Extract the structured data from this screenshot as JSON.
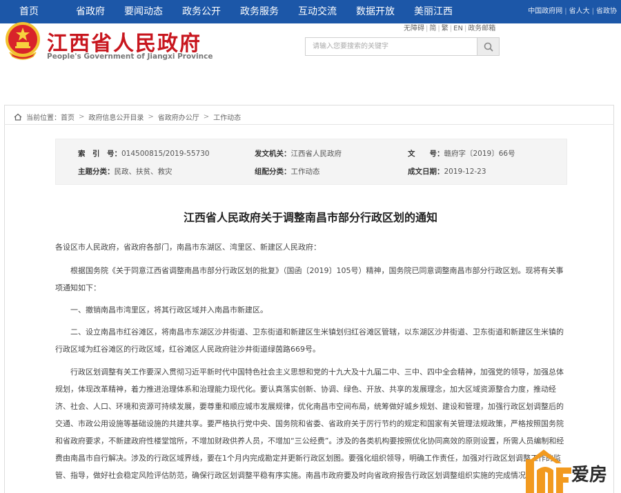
{
  "topnav": {
    "items": [
      "首页",
      "省政府",
      "要闻动态",
      "政务公开",
      "政务服务",
      "互动交流",
      "数据开放",
      "美丽江西"
    ],
    "right_links": [
      "中国政府网",
      "省人大",
      "省政协"
    ]
  },
  "header": {
    "title": "江西省人民政府",
    "subtitle": "People's Government of Jiangxi Province",
    "tools": [
      "无障碍",
      "简",
      "繁",
      "EN",
      "政务邮箱"
    ],
    "search_placeholder": "请输入您要搜索的关键字"
  },
  "breadcrumb": {
    "label": "当前位置：",
    "items": [
      "首页",
      "政府信息公开目录",
      "省政府办公厅",
      "工作动态"
    ]
  },
  "meta": {
    "index_label": "索　引　号：",
    "index_value": "014500815/2019-55730",
    "agency_label": "发文机关：",
    "agency_value": "江西省人民政府",
    "docno_label": "文　　号：",
    "docno_value": "赣府字〔2019〕66号",
    "topic_label": "主题分类：",
    "topic_value": "民政、扶贫、救灾",
    "genre_label": "组配分类：",
    "genre_value": "工作动态",
    "date_label": "成文日期：",
    "date_value": "2019-12-23"
  },
  "document": {
    "title": "江西省人民政府关于调整南昌市部分行政区划的通知",
    "salutation": "各设区市人民政府，省政府各部门，南昌市东湖区、湾里区、新建区人民政府：",
    "p1": "　　根据国务院《关于同意江西省调整南昌市部分行政区划的批复》（国函〔2019〕105号）精神，国务院已同意调整南昌市部分行政区划。现将有关事项通知如下：",
    "p2": "　　一、撤销南昌市湾里区，将其行政区域并入南昌市新建区。",
    "p3": "　　二、设立南昌市红谷滩区，将南昌市东湖区沙井街道、卫东街道和新建区生米镇划归红谷滩区管辖，以东湖区沙井街道、卫东街道和新建区生米镇的行政区域为红谷滩区的行政区域，红谷滩区人民政府驻沙井街道绿茵路669号。",
    "p4": "　　行政区划调整有关工作要深入贯彻习近平新时代中国特色社会主义思想和党的十九大及十九届二中、三中、四中全会精神，加强党的领导，加强总体规划，体现改革精神，着力推进治理体系和治理能力现代化。要认真落实创新、协调、绿色、开放、共享的发展理念，加大区域资源整合力度，推动经济、社会、人口、环境和资源可持续发展，要尊重和顺应城市发展规律，优化南昌市空间布局，统筹做好城乡规划、建设和管理，加强行政区划调整后的交通、市政公用设施等基础设施的共建共享。要严格执行党中央、国务院和省委、省政府关于厉行节约的规定和国家有关管理法规政策，严格按照国务院和省政府要求，不新建政府性楼堂馆所，不增加财政供养人员，不增加“三公经费”。涉及的各类机构要按照优化协同高效的原则设置，所需人员编制和经费由南昌市自行解决。涉及的行政区域界线，要在1个月内完成勘定并更新行政区划图。要强化组织领导，明确工作责任，加强对行政区划调整工作的监管、指导，做好社会稳定风险评估防范，确保行政区划调整平稳有序实施。南昌市政府要及时向省政府报告行政区划调整组织实施的完成情况。"
  },
  "watermark": {
    "text": "爱房"
  },
  "colors": {
    "nav_bg": "#1c57a8",
    "title_red": "#c8161e",
    "watermark_orange": "#f29a1f"
  }
}
